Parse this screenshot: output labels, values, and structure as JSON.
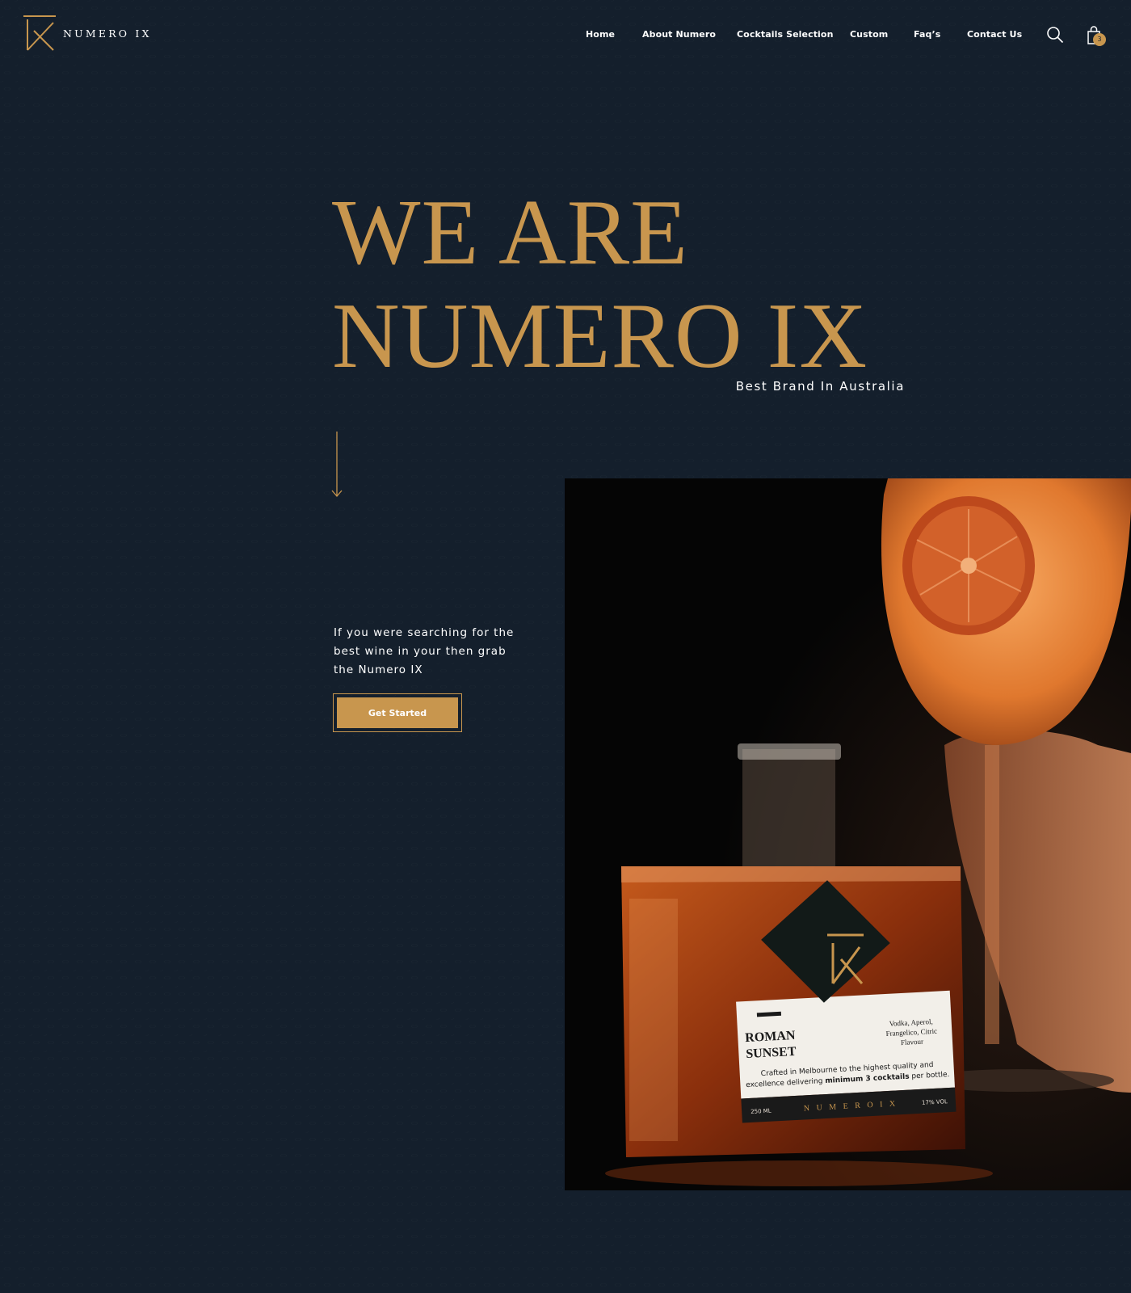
{
  "brand": {
    "name": "NUMERO IX"
  },
  "nav": {
    "items": [
      "Home",
      "About Numero",
      "Cocktails Selection",
      "Custom",
      "Faq’s",
      "Contact Us"
    ]
  },
  "header": {
    "cart_count": "3",
    "search_icon": "search-icon",
    "cart_icon": "shopping-bag-icon"
  },
  "hero": {
    "title_line1": "WE ARE",
    "title_line2": "NUMERO IX",
    "tagline": "Best Brand In Australia",
    "description": "If you were searching for the best wine in your then grab the Numero IX",
    "cta_label": "Get Started"
  },
  "product_label": {
    "name_line1": "ROMAN",
    "name_line2": "SUNSET",
    "ingredients_line1": "Vodka, Aperol,",
    "ingredients_line2": "Frangelico, Citric",
    "ingredients_line3": "Flavour",
    "blurb_line1": "Crafted in Melbourne to the highest quality and",
    "blurb_line2_a": "excellence delivering ",
    "blurb_line2_b": "minimum 3 cocktails",
    "blurb_line2_c": " per bottle.",
    "volume": "250 ML",
    "abv": "17% VOL",
    "brand_strip": "N U M E R O   I X"
  },
  "colors": {
    "background": "#141f2c",
    "accent": "#c8964e",
    "text": "#ffffff"
  }
}
